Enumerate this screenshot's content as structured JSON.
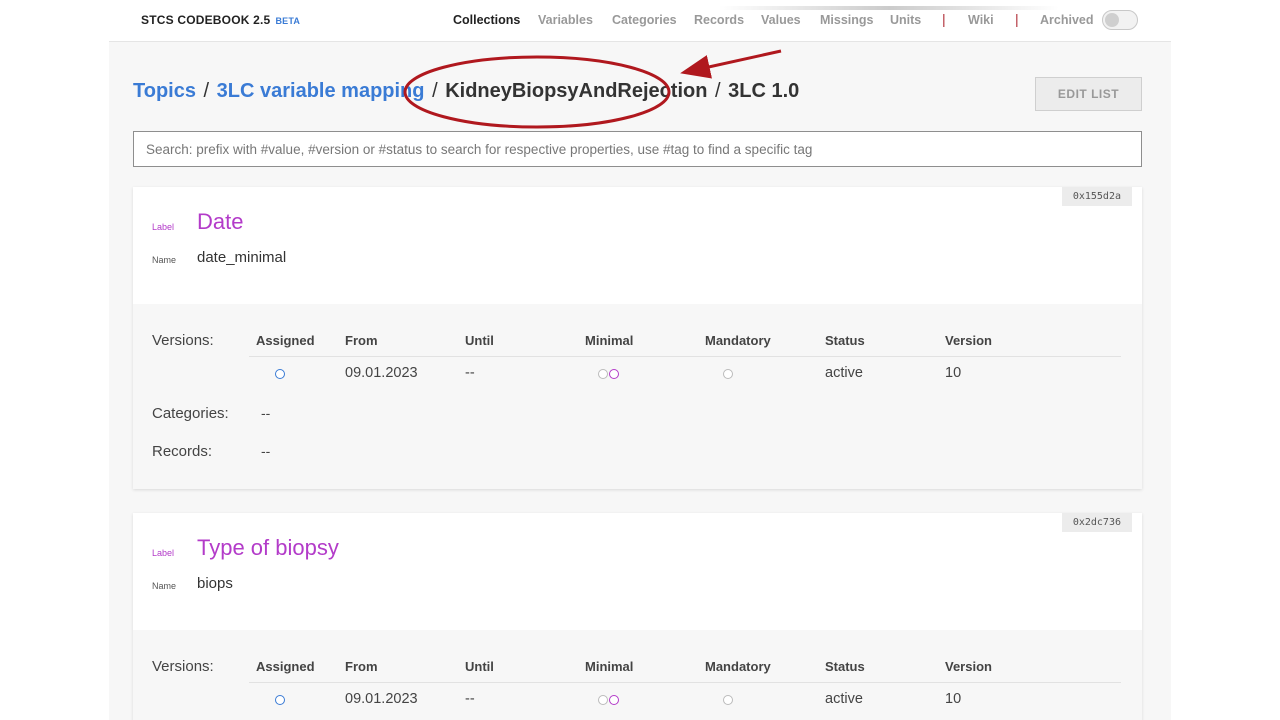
{
  "brand": {
    "title": "STCS CODEBOOK 2.5",
    "badge": "BETA"
  },
  "nav": {
    "items": [
      "Collections",
      "Variables",
      "Categories",
      "Records",
      "Values",
      "Missings",
      "Units",
      "Wiki",
      "Archived"
    ],
    "separator": "|",
    "active": "Collections"
  },
  "breadcrumb": {
    "items": [
      "Topics",
      "3LC variable mapping",
      "KidneyBiopsyAndRejection",
      "3LC 1.0"
    ],
    "separator": "/"
  },
  "toolbar": {
    "edit_label": "EDIT LIST"
  },
  "search": {
    "placeholder": "Search: prefix with #value, #version or #status to search for respective properties, use #tag to find a specific tag",
    "value": ""
  },
  "table": {
    "columns": [
      "Assigned",
      "From",
      "Until",
      "Minimal",
      "Mandatory",
      "Status",
      "Version"
    ]
  },
  "field_labels": {
    "label": "Label",
    "name": "Name",
    "versions": "Versions:",
    "categories": "Categories:",
    "records": "Records:"
  },
  "cards": [
    {
      "id": "0x155d2a",
      "label": "Date",
      "name": "date_minimal",
      "version_row": {
        "from": "09.01.2023",
        "until": "--",
        "status": "active",
        "version": "10"
      },
      "categories": "--",
      "records": "--"
    },
    {
      "id": "0x2dc736",
      "label": "Type of biopsy",
      "name": "biops",
      "version_row": {
        "from": "09.01.2023",
        "until": "--",
        "status": "active",
        "version": "10"
      }
    }
  ],
  "colors": {
    "link": "#3a7bd5",
    "label": "#b33bc9",
    "annotation": "#b0181e",
    "separator": "#b0303a"
  },
  "icons": {
    "assigned": "circle-outline-icon",
    "minimal": "double-circle-icon",
    "mandatory": "circle-outline-icon",
    "archived_toggle": "toggle-switch-icon"
  }
}
